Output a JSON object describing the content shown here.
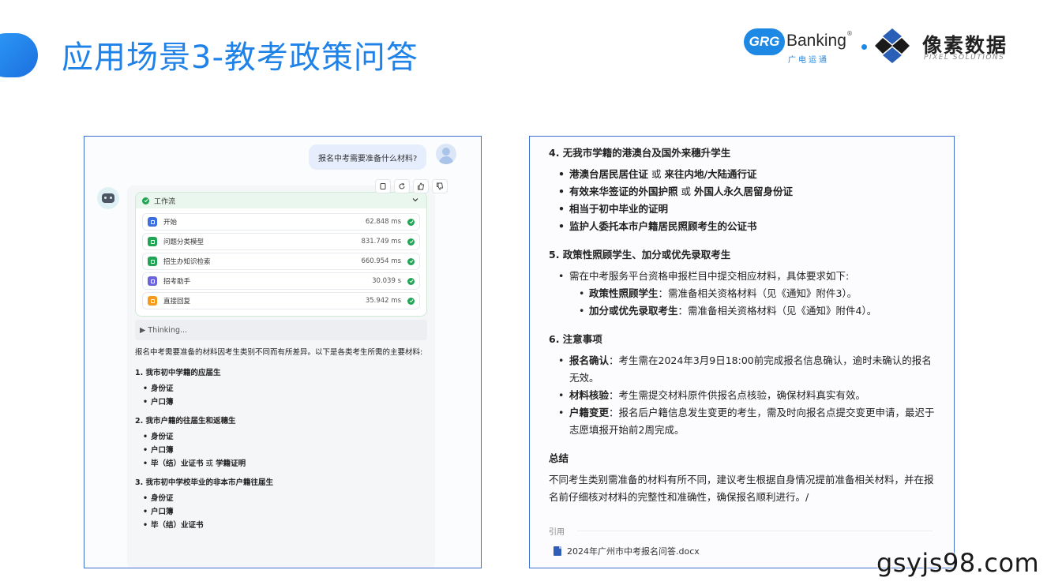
{
  "slide": {
    "title": "应用场景3-教考政策问答",
    "accent_color": "#1e82e8"
  },
  "logos": {
    "grg_badge": "GRG",
    "grg_word": "Banking",
    "grg_registered": "®",
    "grg_chinese": "广电运通",
    "pixel_chinese": "像素数据",
    "pixel_english": "PIXEL SOLUTIONS"
  },
  "left_panel": {
    "user_question": "报名中考需要准备什么材料?",
    "actions": [
      "copy-icon",
      "refresh-icon",
      "thumbs-up-icon",
      "thumbs-down-icon"
    ],
    "workflow": {
      "label": "工作流",
      "steps": [
        {
          "name": "开始",
          "time": "62.848 ms",
          "color": "#3b6fe0"
        },
        {
          "name": "问题分类模型",
          "time": "831.749 ms",
          "color": "#22a455"
        },
        {
          "name": "招生办知识检索",
          "time": "660.954 ms",
          "color": "#22a455"
        },
        {
          "name": "招考助手",
          "time": "30.039 s",
          "color": "#6b63d9"
        },
        {
          "name": "直接回复",
          "time": "35.942 ms",
          "color": "#f59a1b"
        }
      ]
    },
    "thinking": "▶ Thinking...",
    "answer": {
      "intro": "报名中考需要准备的材料因考生类别不同而有所差异。以下是各类考生所需的主要材料:",
      "sections": [
        {
          "title": "1. 我市初中学籍的应届生",
          "items": [
            "身份证",
            "户口簿"
          ]
        },
        {
          "title": "2. 我市户籍的往届生和返穗生",
          "items": [
            "身份证",
            "户口簿"
          ],
          "item3_a": "毕（结）业证书",
          "item3_or": " 或 ",
          "item3_b": "学籍证明"
        },
        {
          "title": "3. 我市初中学校毕业的非本市户籍往届生",
          "items": [
            "身份证",
            "户口簿",
            "毕（结）业证书"
          ]
        }
      ]
    }
  },
  "right_panel": {
    "sec4": {
      "title": "4. 无我市学籍的港澳台及国外来穗升学生",
      "i1a": "港澳台居民居住证",
      "i1or": " 或 ",
      "i1b": "来往内地/大陆通行证",
      "i2a": "有效来华签证的外国护照",
      "i2or": " 或 ",
      "i2b": "外国人永久居留身份证",
      "i3": "相当于初中毕业的证明",
      "i4": "监护人委托本市户籍居民照顾考生的公证书"
    },
    "sec5": {
      "title": "5. 政策性照顾学生、加分或优先录取考生",
      "i1": "需在中考服务平台资格申报栏目中提交相应材料，具体要求如下:",
      "s1k": "政策性照顾学生",
      "s1v": "：需准备相关资格材料（见《通知》附件3）。",
      "s2k": "加分或优先录取考生",
      "s2v": "：需准备相关资格材料（见《通知》附件4）。"
    },
    "sec6": {
      "title": "6. 注意事项",
      "i1k": "报名确认",
      "i1v": "：考生需在2024年3月9日18:00前完成报名信息确认，逾时未确认的报名无效。",
      "i2k": "材料核验",
      "i2v": "：考生需提交材料原件供报名点核验，确保材料真实有效。",
      "i3k": "户籍变更",
      "i3v": "：报名后户籍信息发生变更的考生，需及时向报名点提交变更申请，最迟于志愿填报开始前2周完成。"
    },
    "summary": {
      "title": "总结",
      "text": "不同考生类别需准备的材料有所不同，建议考生根据自身情况提前准备相关材料，并在报名前仔细核对材料的完整性和准确性，确保报名顺利进行。/"
    },
    "reference_label": "引用",
    "reference_doc": "2024年广州市中考报名问答.docx"
  },
  "watermark": "gsyjs98.com"
}
